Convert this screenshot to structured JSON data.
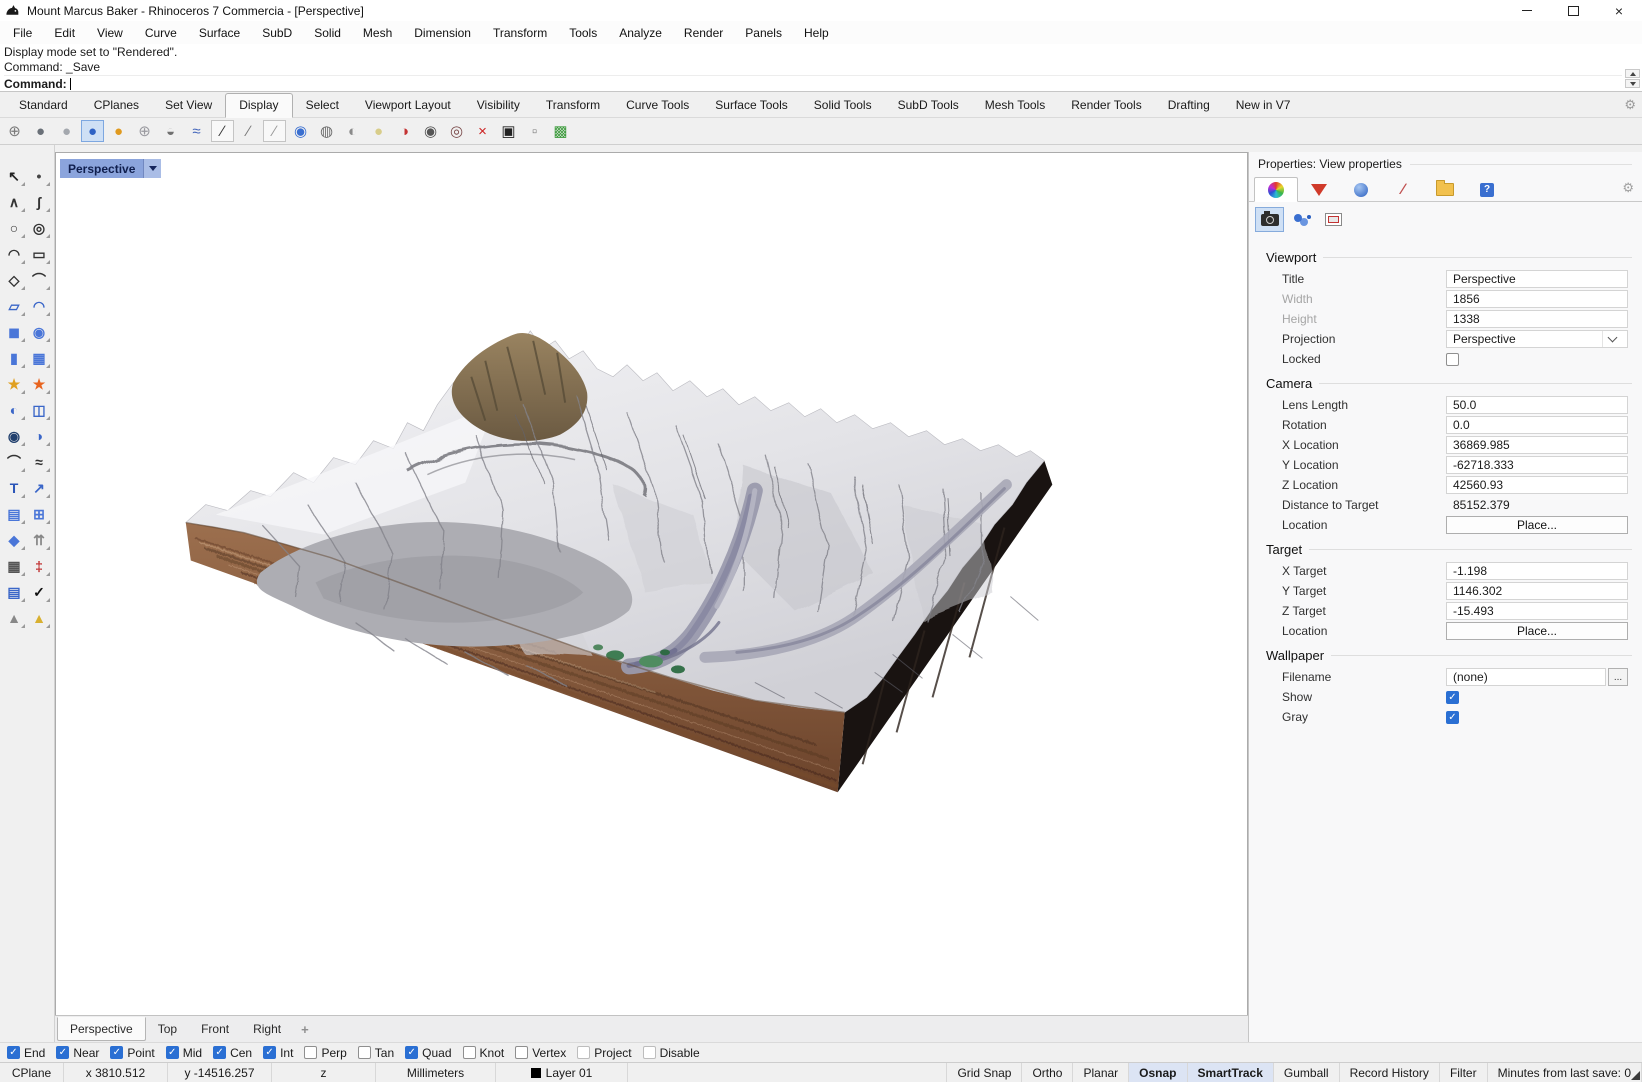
{
  "window": {
    "title": "Mount Marcus Baker - Rhinoceros 7 Commercia - [Perspective]"
  },
  "menu_bar": [
    "File",
    "Edit",
    "View",
    "Curve",
    "Surface",
    "SubD",
    "Solid",
    "Mesh",
    "Dimension",
    "Transform",
    "Tools",
    "Analyze",
    "Render",
    "Panels",
    "Help"
  ],
  "command_area": {
    "history_line_1": "Display mode set to \"Rendered\".",
    "history_line_2": "Command: _Save",
    "prompt_label": "Command:"
  },
  "toolbar_tabs": {
    "active": "Display",
    "items": [
      "Standard",
      "CPlanes",
      "Set View",
      "Display",
      "Select",
      "Viewport Layout",
      "Visibility",
      "Transform",
      "Curve Tools",
      "Surface Tools",
      "Solid Tools",
      "SubD Tools",
      "Mesh Tools",
      "Render Tools",
      "Drafting",
      "New in V7"
    ]
  },
  "display_toolbar": [
    {
      "name": "wireframe-mode",
      "glyph": "⊕",
      "color": "#7a7a7a"
    },
    {
      "name": "shaded-mode",
      "glyph": "●",
      "color": "#6a7078"
    },
    {
      "name": "ghosted-mode",
      "glyph": "●",
      "color": "#a4a8ae"
    },
    {
      "name": "rendered-mode",
      "glyph": "●",
      "color": "#2f62c4",
      "active": true
    },
    {
      "name": "raytraced-mode",
      "glyph": "●",
      "color": "#e09a1f"
    },
    {
      "name": "xray-mode",
      "glyph": "⊕",
      "color": "#9a9aa0"
    },
    {
      "name": "technical-mode",
      "glyph": "◒",
      "color": "#707070"
    },
    {
      "name": "artistic-mode",
      "glyph": "≈",
      "color": "#4466bb"
    },
    {
      "name": "pen-mode",
      "glyph": "∕",
      "color": "#333333",
      "boxed": true
    },
    {
      "name": "pen-light-mode",
      "glyph": "∕",
      "color": "#777777"
    },
    {
      "name": "pen-lines-mode",
      "glyph": "∕",
      "color": "#999999",
      "boxed": true
    },
    {
      "name": "render-preview-mode",
      "glyph": "◉",
      "color": "#3a6fd0"
    },
    {
      "name": "shade-selected",
      "glyph": "◍",
      "color": "#6a6a6a"
    },
    {
      "name": "flat-shade",
      "glyph": "◐",
      "color": "#8a8a8a"
    },
    {
      "name": "arctic-mode",
      "glyph": "●",
      "color": "#d8cd8a"
    },
    {
      "name": "cplane-target",
      "glyph": "◑",
      "color": "#c43333"
    },
    {
      "name": "eye-view",
      "glyph": "◉",
      "color": "#555555"
    },
    {
      "name": "pin-view",
      "glyph": "◎",
      "color": "#7a4a4a"
    },
    {
      "name": "no-shade",
      "glyph": "×",
      "color": "#cc2222"
    },
    {
      "name": "monitor-display",
      "glyph": "▣",
      "color": "#222222"
    },
    {
      "name": "wire-cube",
      "glyph": "▫",
      "color": "#777777"
    },
    {
      "name": "stereo-cube",
      "glyph": "▩",
      "color": "#3a9a3a"
    }
  ],
  "left_toolbar": [
    {
      "name": "select-pointer",
      "glyph": "↖",
      "color": "#222222"
    },
    {
      "name": "single-point",
      "glyph": "•",
      "color": "#444444"
    },
    {
      "name": "polyline",
      "glyph": "∧",
      "color": "#333333"
    },
    {
      "name": "control-point-curve",
      "glyph": "ʃ",
      "color": "#333333"
    },
    {
      "name": "circle",
      "glyph": "○",
      "color": "#333333"
    },
    {
      "name": "ellipse",
      "glyph": "◎",
      "color": "#333333"
    },
    {
      "name": "arc",
      "glyph": "◠",
      "color": "#333333"
    },
    {
      "name": "rectangle",
      "glyph": "▭",
      "color": "#333333"
    },
    {
      "name": "polygon",
      "glyph": "◇",
      "color": "#333333"
    },
    {
      "name": "curve-blend",
      "glyph": "⌒",
      "color": "#333333"
    },
    {
      "name": "surface-plane",
      "glyph": "▱",
      "color": "#3a66c8"
    },
    {
      "name": "surface-curved",
      "glyph": "◠",
      "color": "#3a66c8"
    },
    {
      "name": "box",
      "glyph": "◼",
      "color": "#4a76d8"
    },
    {
      "name": "sphere",
      "glyph": "◉",
      "color": "#4a76d8"
    },
    {
      "name": "cylinder",
      "glyph": "▮",
      "color": "#4a76d8"
    },
    {
      "name": "surface-grid",
      "glyph": "▦",
      "color": "#4a76d8"
    },
    {
      "name": "explode",
      "glyph": "★",
      "color": "#e0a020"
    },
    {
      "name": "explode-flash",
      "glyph": "★",
      "color": "#e8641f"
    },
    {
      "name": "trim",
      "glyph": "◐",
      "color": "#3a66c8"
    },
    {
      "name": "split",
      "glyph": "◫",
      "color": "#3a66c8"
    },
    {
      "name": "boolean-union",
      "glyph": "◉",
      "color": "#22406e"
    },
    {
      "name": "boolean-difference",
      "glyph": "◑",
      "color": "#3a66c8"
    },
    {
      "name": "fillet-curves",
      "glyph": "⌒",
      "color": "#333333"
    },
    {
      "name": "blend-curve",
      "glyph": "≈",
      "color": "#333333"
    },
    {
      "name": "text",
      "glyph": "T",
      "color": "#2a55b8"
    },
    {
      "name": "move-copy",
      "glyph": "↗",
      "color": "#3a66c8"
    },
    {
      "name": "array-blocks",
      "glyph": "▤",
      "color": "#4a76d8"
    },
    {
      "name": "copy-object",
      "glyph": "⊞",
      "color": "#4a76d8"
    },
    {
      "name": "solid-tools",
      "glyph": "◆",
      "color": "#4a76d8"
    },
    {
      "name": "extrude",
      "glyph": "⇈",
      "color": "#888888"
    },
    {
      "name": "grid-array",
      "glyph": "▦",
      "color": "#555555"
    },
    {
      "name": "dimension",
      "glyph": "‡",
      "color": "#c03030"
    },
    {
      "name": "layer-tools",
      "glyph": "▤",
      "color": "#3a66c8"
    },
    {
      "name": "check-selection",
      "glyph": "✓",
      "color": "#111111"
    },
    {
      "name": "mesh-primitives",
      "glyph": "▲",
      "color": "#888888"
    },
    {
      "name": "pyramid",
      "glyph": "▲",
      "color": "#d8b030"
    }
  ],
  "viewport": {
    "label": "Perspective",
    "active_tab": "Perspective",
    "tabs": [
      "Perspective",
      "Top",
      "Front",
      "Right"
    ],
    "add_tab_glyph": "+"
  },
  "properties_panel": {
    "title": "Properties: View properties",
    "gear_glyph": "⚙",
    "tabs": [
      {
        "name": "view-properties-tab",
        "icon": "color-wheel",
        "active": true
      },
      {
        "name": "material-tab",
        "icon": "red-material"
      },
      {
        "name": "display-mode-tab",
        "icon": "blue-sphere"
      },
      {
        "name": "annotation-tab",
        "icon": "pencil",
        "glyph": "∕"
      },
      {
        "name": "files-tab",
        "icon": "folder"
      },
      {
        "name": "help-tab",
        "icon": "help",
        "glyph": "?"
      }
    ],
    "subtabs": [
      {
        "name": "camera-subtab",
        "icon": "camera",
        "active": true
      },
      {
        "name": "render-spheres-subtab",
        "icon": "lens-spheres"
      },
      {
        "name": "viewport-frame-subtab",
        "icon": "viewport-rect"
      }
    ],
    "sections": [
      {
        "title": "Viewport",
        "rows": [
          {
            "label": "Title",
            "value": "Perspective",
            "type": "input"
          },
          {
            "label": "Width",
            "value": "1856",
            "type": "input",
            "dim": true
          },
          {
            "label": "Height",
            "value": "1338",
            "type": "input",
            "dim": true
          },
          {
            "label": "Projection",
            "value": "Perspective",
            "type": "select"
          },
          {
            "label": "Locked",
            "type": "checkbox",
            "checked": false
          }
        ]
      },
      {
        "title": "Camera",
        "rows": [
          {
            "label": "Lens Length",
            "value": "50.0",
            "type": "input"
          },
          {
            "label": "Rotation",
            "value": "0.0",
            "type": "input"
          },
          {
            "label": "X Location",
            "value": "36869.985",
            "type": "input"
          },
          {
            "label": "Y Location",
            "value": "-62718.333",
            "type": "input"
          },
          {
            "label": "Z Location",
            "value": "42560.93",
            "type": "input"
          },
          {
            "label": "Distance to Target",
            "value": "85152.379",
            "type": "readonly"
          },
          {
            "label": "Location",
            "value": "Place...",
            "type": "button"
          }
        ]
      },
      {
        "title": "Target",
        "rows": [
          {
            "label": "X Target",
            "value": "-1.198",
            "type": "input"
          },
          {
            "label": "Y Target",
            "value": "1146.302",
            "type": "input"
          },
          {
            "label": "Z Target",
            "value": "-15.493",
            "type": "input"
          },
          {
            "label": "Location",
            "value": "Place...",
            "type": "button"
          }
        ]
      },
      {
        "title": "Wallpaper",
        "rows": [
          {
            "label": "Filename",
            "value": "(none)",
            "type": "file",
            "button": "..."
          },
          {
            "label": "Show",
            "type": "checkbox",
            "checked": true
          },
          {
            "label": "Gray",
            "type": "checkbox",
            "checked": true
          }
        ]
      }
    ]
  },
  "osnap_bar": [
    {
      "label": "End",
      "checked": true
    },
    {
      "label": "Near",
      "checked": true
    },
    {
      "label": "Point",
      "checked": true
    },
    {
      "label": "Mid",
      "checked": true
    },
    {
      "label": "Cen",
      "checked": true
    },
    {
      "label": "Int",
      "checked": true
    },
    {
      "label": "Perp",
      "checked": false
    },
    {
      "label": "Tan",
      "checked": false
    },
    {
      "label": "Quad",
      "checked": true
    },
    {
      "label": "Knot",
      "checked": false
    },
    {
      "label": "Vertex",
      "checked": false
    },
    {
      "label": "Project",
      "checked": false,
      "dim": true
    },
    {
      "label": "Disable",
      "checked": false,
      "dim": true
    }
  ],
  "status_bar": {
    "left": [
      {
        "label": "CPlane"
      },
      {
        "label": "x 3810.512",
        "coord": true
      },
      {
        "label": "y -14516.257",
        "coord": true
      },
      {
        "label": "z",
        "coord": true
      },
      {
        "label": "Millimeters"
      },
      {
        "label": "Layer 01",
        "swatch": "#000000"
      }
    ],
    "right": [
      {
        "label": "Grid Snap"
      },
      {
        "label": "Ortho"
      },
      {
        "label": "Planar"
      },
      {
        "label": "Osnap",
        "active": true
      },
      {
        "label": "SmartTrack",
        "active": true
      },
      {
        "label": "Gumball"
      },
      {
        "label": "Record History"
      },
      {
        "label": "Filter"
      },
      {
        "label": "Minutes from last save: 0"
      }
    ]
  },
  "colors": {
    "accent_blue": "#2a6fd3",
    "viewport_label_bg": "#8ba4dc",
    "active_toggle_bg": "#dce4f4",
    "terrain_dirt": "#855a3d",
    "terrain_snow": "#e6e6ea"
  }
}
